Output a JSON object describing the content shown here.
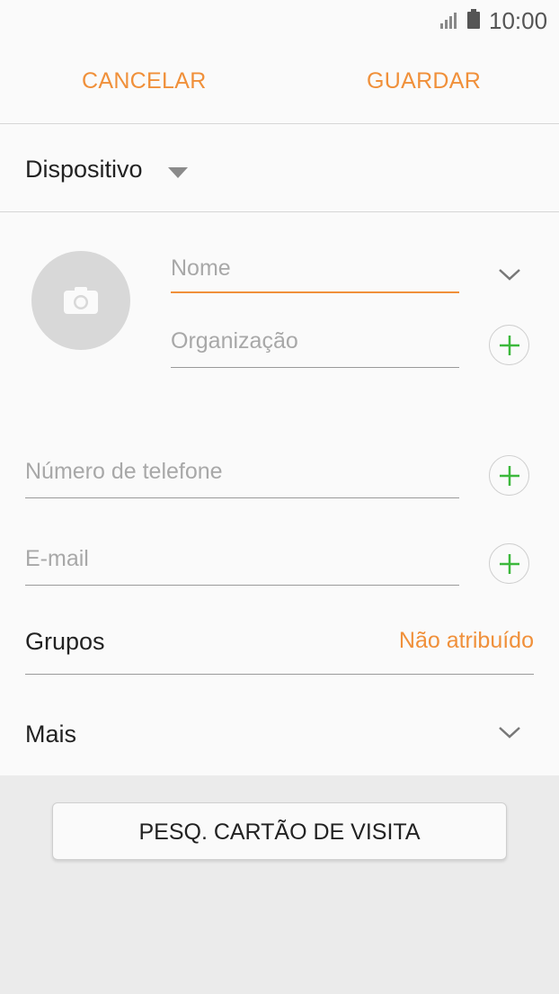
{
  "status_bar": {
    "time": "10:00"
  },
  "action_bar": {
    "cancel_label": "CANCELAR",
    "save_label": "GUARDAR"
  },
  "storage": {
    "label": "Dispositivo"
  },
  "form": {
    "name_placeholder": "Nome",
    "organization_placeholder": "Organização",
    "phone_placeholder": "Número de telefone",
    "email_placeholder": "E-mail"
  },
  "groups": {
    "label": "Grupos",
    "value": "Não atribuído"
  },
  "more": {
    "label": "Mais"
  },
  "scan_button": {
    "label": "PESQ. CARTÃO DE VISITA"
  },
  "colors": {
    "accent": "#f0903a",
    "add_icon": "#3cb83c",
    "avatar_bg": "#d8d8d8"
  }
}
